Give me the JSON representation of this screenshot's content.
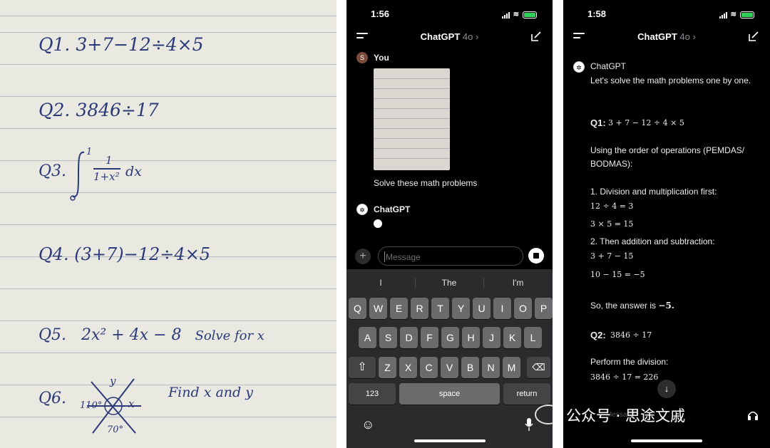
{
  "notebook": {
    "q1": {
      "label": "Q1.",
      "expr": "3+7−12÷4×5"
    },
    "q2": {
      "label": "Q2.",
      "expr": "3846÷17"
    },
    "q3": {
      "label": "Q3.",
      "upper": "1",
      "lower": "0",
      "num": "1",
      "den": "1+x²",
      "dx": "dx"
    },
    "q4": {
      "label": "Q4.",
      "expr": "(3+7)−12÷4×5"
    },
    "q5": {
      "label": "Q5.",
      "expr": "2x² + 4x − 8",
      "note": "Solve for x"
    },
    "q6": {
      "label": "Q6.",
      "angle1": "110°",
      "angle2": "70°",
      "var_x": "x",
      "var_y": "y",
      "note": "Find x and y"
    }
  },
  "phone1": {
    "time": "1:56",
    "title": "ChatGPT",
    "model": "4o ›",
    "user_name": "You",
    "user_initial": "S",
    "user_message": "Solve these math problems",
    "assistant_name": "ChatGPT",
    "input_placeholder": "Message",
    "suggestions": [
      "I",
      "The",
      "I'm"
    ],
    "row1": [
      "Q",
      "W",
      "E",
      "R",
      "T",
      "Y",
      "U",
      "I",
      "O",
      "P"
    ],
    "row2": [
      "A",
      "S",
      "D",
      "F",
      "G",
      "H",
      "J",
      "K",
      "L"
    ],
    "row3": [
      "Z",
      "X",
      "C",
      "V",
      "B",
      "N",
      "M"
    ],
    "key_numbers": "123",
    "key_space": "space",
    "key_return": "return"
  },
  "phone2": {
    "time": "1:58",
    "title": "ChatGPT",
    "model": "4o ›",
    "assistant_name": "ChatGPT",
    "intro": "Let's solve the math problems one by one.",
    "q1_label": "Q1:",
    "q1_expr": "3 + 7 − 12 ÷ 4 × 5",
    "order_text": "Using the order of operations (PEMDAS/ BODMAS):",
    "step1": "1.  Division and multiplication first:",
    "step1_a": "12 ÷ 4 = 3",
    "step1_b": "3 × 5 = 15",
    "step2": "2.  Then addition and subtraction:",
    "step2_a": "3 + 7 − 15",
    "step2_b": "10 − 15 = −5",
    "answer_prefix": "So, the answer is",
    "answer_value": "−5.",
    "q2_label": "Q2:",
    "q2_expr": "3846 ÷ 17",
    "perform": "Perform the division:",
    "q2_result": "3846 ÷ 17 = 226",
    "input_placeholder": "Message"
  },
  "watermark": "公众号 · 思途文戚"
}
